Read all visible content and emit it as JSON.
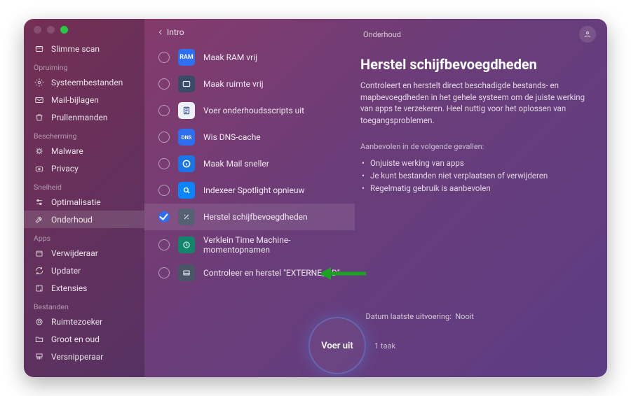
{
  "header": {
    "page_label": "Onderhoud"
  },
  "back": {
    "label": "Intro"
  },
  "sidebar": {
    "top": {
      "label": "Slimme scan"
    },
    "sections": [
      {
        "title": "Opruiming",
        "items": [
          {
            "label": "Systeembestanden"
          },
          {
            "label": "Mail-bijlagen"
          },
          {
            "label": "Prullenmanden"
          }
        ]
      },
      {
        "title": "Bescherming",
        "items": [
          {
            "label": "Malware"
          },
          {
            "label": "Privacy"
          }
        ]
      },
      {
        "title": "Snelheid",
        "items": [
          {
            "label": "Optimalisatie"
          },
          {
            "label": "Onderhoud"
          }
        ]
      },
      {
        "title": "Apps",
        "items": [
          {
            "label": "Verwijderaar"
          },
          {
            "label": "Updater"
          },
          {
            "label": "Extensies"
          }
        ]
      },
      {
        "title": "Bestanden",
        "items": [
          {
            "label": "Ruimtezoeker"
          },
          {
            "label": "Groot en oud"
          },
          {
            "label": "Versnipperaar"
          }
        ]
      }
    ]
  },
  "tasks": [
    {
      "label": "Maak RAM vrij",
      "icon_text": "RAM",
      "color": "#2d6ff0"
    },
    {
      "label": "Maak ruimte vrij",
      "icon_text": "",
      "color": "#3b4a66"
    },
    {
      "label": "Voer onderhoudsscripts uit",
      "icon_text": "",
      "color": "#2f4aa0"
    },
    {
      "label": "Wis DNS-cache",
      "icon_text": "DNS",
      "color": "#2d6ff0"
    },
    {
      "label": "Maak Mail sneller",
      "icon_text": "",
      "color": "#1a76e6"
    },
    {
      "label": "Indexeer Spotlight opnieuw",
      "icon_text": "",
      "color": "#0b84ff"
    },
    {
      "label": "Herstel schijfbevoegdheden",
      "icon_text": "",
      "color": "#566073"
    },
    {
      "label": "Verklein Time Machine-momentopnamen",
      "icon_text": "",
      "color": "#12856a"
    },
    {
      "label": "Controleer en herstel \"EXTERNE_HD\"",
      "icon_text": "",
      "color": "#4a5568"
    }
  ],
  "detail": {
    "title": "Herstel schijfbevoegdheden",
    "description": "Controleert en herstelt direct beschadigde bestands- en mapbevoegdheden in het gehele systeem om de juiste werking van apps te verzekeren. Heel nuttig voor het oplossen van toegangsproblemen.",
    "rec_title": "Aanbevolen in de volgende gevallen:",
    "recs": [
      "Onjuiste werking van apps",
      "Je kunt bestanden niet verplaatsen of verwijderen",
      "Regelmatig gebruik is aanbevolen"
    ],
    "lastrun_label": "Datum laatste uitvoering:",
    "lastrun_value": "Nooit"
  },
  "run": {
    "label": "Voer uit",
    "count_label": "1 taak"
  }
}
